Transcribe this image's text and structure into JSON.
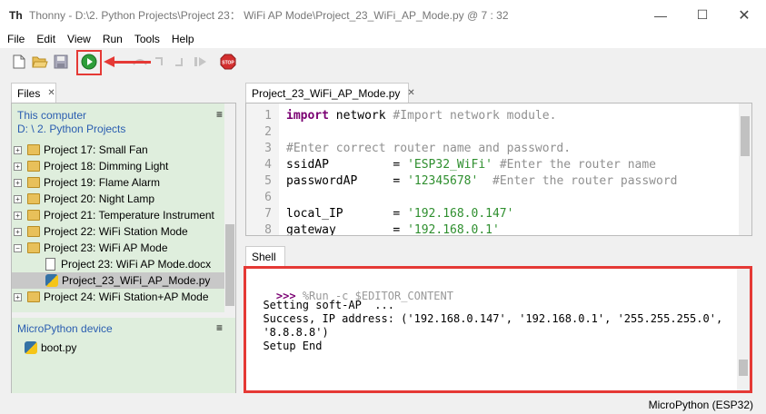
{
  "window": {
    "title": "Thonny  -  D:\\2. Python Projects\\Project 23： WiFi AP Mode\\Project_23_WiFi_AP_Mode.py  @  7 : 32"
  },
  "menu": [
    "File",
    "Edit",
    "View",
    "Run",
    "Tools",
    "Help"
  ],
  "toolbar": {
    "stop_label": "STOP"
  },
  "files": {
    "tab_label": "Files",
    "this_computer": "This computer",
    "path": "D: \\ 2. Python Projects",
    "tree": [
      {
        "label": "Project 17:  Small Fan",
        "kind": "folder",
        "exp": "+"
      },
      {
        "label": "Project 18:  Dimming Light",
        "kind": "folder",
        "exp": "+"
      },
      {
        "label": "Project 19:  Flame Alarm",
        "kind": "folder",
        "exp": "+"
      },
      {
        "label": "Project 20:  Night Lamp",
        "kind": "folder",
        "exp": "+"
      },
      {
        "label": "Project 21:  Temperature Instrument",
        "kind": "folder",
        "exp": "+"
      },
      {
        "label": "Project 22:  WiFi Station Mode",
        "kind": "folder",
        "exp": "+"
      },
      {
        "label": "Project 23:  WiFi AP Mode",
        "kind": "folder",
        "exp": "−"
      },
      {
        "label": "Project 23:  WiFi AP Mode.docx",
        "kind": "doc",
        "exp": ""
      },
      {
        "label": "Project_23_WiFi_AP_Mode.py",
        "kind": "py",
        "exp": ""
      },
      {
        "label": "Project 24:  WiFi Station+AP Mode",
        "kind": "folder",
        "exp": "+"
      }
    ],
    "micropython_device": "MicroPython device",
    "device_files": [
      "boot.py"
    ]
  },
  "editor": {
    "tab_label": "Project_23_WiFi_AP_Mode.py",
    "lines": [
      {
        "n": "1",
        "parts": [
          [
            "kw",
            "import"
          ],
          [
            "",
            " network "
          ],
          [
            "cm",
            "#Import network module."
          ]
        ]
      },
      {
        "n": "2",
        "parts": []
      },
      {
        "n": "3",
        "parts": [
          [
            "cm",
            "#Enter correct router name and password."
          ]
        ]
      },
      {
        "n": "4",
        "parts": [
          [
            "",
            "ssidAP         = "
          ],
          [
            "st",
            "'ESP32_WiFi'"
          ],
          [
            "",
            " "
          ],
          [
            "cm",
            "#Enter the router name"
          ]
        ]
      },
      {
        "n": "5",
        "parts": [
          [
            "",
            "passwordAP     = "
          ],
          [
            "st",
            "'12345678'"
          ],
          [
            "",
            "  "
          ],
          [
            "cm",
            "#Enter the router password"
          ]
        ]
      },
      {
        "n": "6",
        "parts": []
      },
      {
        "n": "7",
        "parts": [
          [
            "",
            "local_IP       = "
          ],
          [
            "st",
            "'192.168.0.147'"
          ]
        ]
      },
      {
        "n": "8",
        "parts": [
          [
            "",
            "gateway        = "
          ],
          [
            "st",
            "'192.168.0.1'"
          ]
        ]
      }
    ]
  },
  "shell": {
    "tab_label": "Shell",
    "prompt": ">>>",
    "command": " %Run -c $EDITOR_CONTENT",
    "output": [
      "  Setting soft-AP  ...",
      "  Success, IP address: ('192.168.0.147', '192.168.0.1', '255.255.255.0',",
      "  '8.8.8.8')",
      "  Setup End"
    ]
  },
  "status": {
    "interpreter": "MicroPython (ESP32)"
  },
  "colors": {
    "highlight": "#e53935",
    "files_bg": "#dfeedd",
    "keyword": "#7a0072",
    "string": "#2f8f2f",
    "comment": "#909090"
  }
}
